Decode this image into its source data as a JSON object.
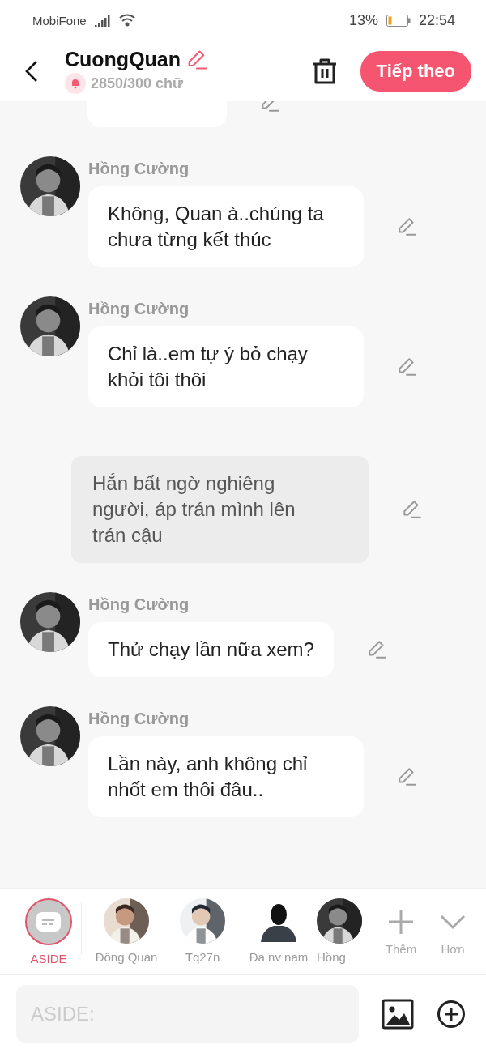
{
  "status_bar": {
    "carrier": "MobiFone",
    "battery": "13%",
    "time": "22:54"
  },
  "header": {
    "title": "CuongQuan",
    "count": "2850/300 chữ",
    "next_button": "Tiếp theo"
  },
  "messages": [
    {
      "kind": "character"
    },
    {
      "kind": "character",
      "speaker": "Hồng Cường",
      "text": "Không, Quan à..chúng ta chưa từng kết thúc"
    },
    {
      "kind": "character",
      "speaker": "Hồng Cường",
      "text": "Chỉ là..em tự ý bỏ chạy khỏi tôi thôi"
    },
    {
      "kind": "narration",
      "text": "Hắn bất ngờ nghiêng người, áp trán mình lên trán cậu"
    },
    {
      "kind": "character",
      "speaker": "Hồng Cường",
      "text": "Thử chạy lần nữa xem?"
    },
    {
      "kind": "character",
      "speaker": "Hồng Cường",
      "text": "Lần này, anh không chỉ nhốt em thôi đâu.."
    }
  ],
  "characters": [
    {
      "kind": "aside",
      "name": "ASIDE",
      "selected": true
    },
    {
      "kind": "picture",
      "name": "Đông Quan",
      "selected": false
    },
    {
      "kind": "picture",
      "name": "Tq27n",
      "selected": false
    },
    {
      "kind": "silhouette",
      "name": "Đa nv nam",
      "selected": false
    },
    {
      "kind": "picture",
      "name": "Hồng",
      "selected": false
    }
  ],
  "actions": [
    {
      "kind": "add",
      "label": "Thêm"
    },
    {
      "kind": "more",
      "label": "Hơn"
    }
  ],
  "composer": {
    "placeholder": "ASIDE:"
  }
}
